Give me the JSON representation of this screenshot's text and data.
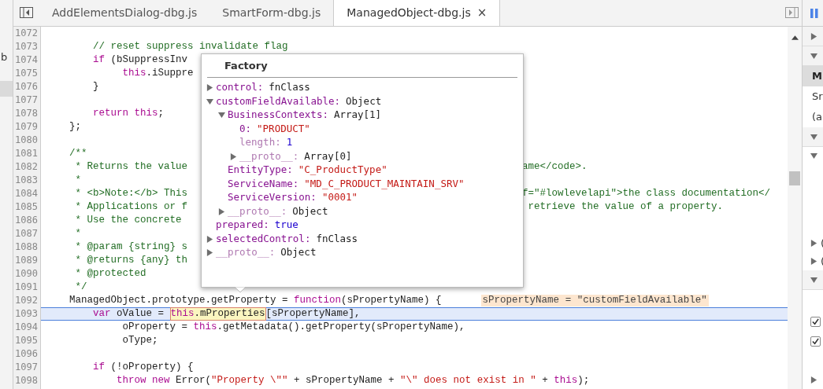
{
  "left_strip": {
    "text": "b"
  },
  "tabs": [
    {
      "label": "AddElementsDialog-dbg.js",
      "selected": false
    },
    {
      "label": "SmartForm-dbg.js",
      "selected": false
    },
    {
      "label": "ManagedObject-dbg.js",
      "selected": true,
      "close": "×"
    }
  ],
  "code": [
    {
      "number": "1072",
      "current": false
    },
    {
      "number": "1073",
      "current": false,
      "tokens": [
        {
          "kind": "comment",
          "text": "        // reset suppress invalidate flag"
        }
      ]
    },
    {
      "number": "1074",
      "current": false,
      "tokens": [
        {
          "kind": "keyword",
          "text": "        if"
        },
        {
          "kind": "plain",
          "text": " (bSuppressInv"
        }
      ]
    },
    {
      "number": "1075",
      "current": false,
      "tokens": [
        {
          "kind": "keyword",
          "text": "             this"
        },
        {
          "kind": "plain",
          "text": ".iSuppre"
        }
      ]
    },
    {
      "number": "1076",
      "current": false,
      "tokens": [
        {
          "kind": "plain",
          "text": "        }"
        }
      ]
    },
    {
      "number": "1077",
      "current": false
    },
    {
      "number": "1078",
      "current": false,
      "tokens": [
        {
          "kind": "keyword",
          "text": "        return this"
        },
        {
          "kind": "plain",
          "text": ";"
        }
      ]
    },
    {
      "number": "1079",
      "current": false,
      "tokens": [
        {
          "kind": "plain",
          "text": "    };"
        }
      ]
    },
    {
      "number": "1080",
      "current": false
    },
    {
      "number": "1081",
      "current": false,
      "tokens": [
        {
          "kind": "comment",
          "text": "    /**"
        }
      ]
    },
    {
      "number": "1082",
      "current": false,
      "tokens": [
        {
          "kind": "comment",
          "text": "     * Returns the value"
        }
      ],
      "right": [
        {
          "kind": "comment",
          "text": "ame</code>."
        }
      ]
    },
    {
      "number": "1083",
      "current": false,
      "tokens": [
        {
          "kind": "comment",
          "text": "     *"
        }
      ]
    },
    {
      "number": "1084",
      "current": false,
      "tokens": [
        {
          "kind": "comment",
          "text": "     * <b>Note:</b> This"
        }
      ],
      "right": [
        {
          "kind": "comment",
          "text": "f=\"#lowlevelapi\">the class documentation</"
        }
      ]
    },
    {
      "number": "1085",
      "current": false,
      "tokens": [
        {
          "kind": "comment",
          "text": "     * Applications or f"
        }
      ],
      "right": [
        {
          "kind": "comment",
          "text": " retrieve the value of a property."
        }
      ]
    },
    {
      "number": "1086",
      "current": false,
      "tokens": [
        {
          "kind": "comment",
          "text": "     * Use the concrete"
        }
      ]
    },
    {
      "number": "1087",
      "current": false,
      "tokens": [
        {
          "kind": "comment",
          "text": "     *"
        }
      ]
    },
    {
      "number": "1088",
      "current": false,
      "tokens": [
        {
          "kind": "comment",
          "text": "     * @param {string} s"
        }
      ]
    },
    {
      "number": "1089",
      "current": false,
      "tokens": [
        {
          "kind": "comment",
          "text": "     * @returns {any} th"
        }
      ]
    },
    {
      "number": "1090",
      "current": false,
      "tokens": [
        {
          "kind": "comment",
          "text": "     * @protected"
        }
      ]
    },
    {
      "number": "1091",
      "current": false,
      "tokens": [
        {
          "kind": "comment",
          "text": "     */"
        }
      ]
    },
    {
      "number": "1092",
      "current": false,
      "tokens": [
        {
          "kind": "plain",
          "text": "    ManagedObject.prototype.getProperty = "
        },
        {
          "kind": "keyword",
          "text": "function"
        },
        {
          "kind": "plain",
          "text": "(sPropertyName) {"
        },
        {
          "kind": "hint",
          "text": "sPropertyName = \"customFieldAvailable\""
        }
      ]
    },
    {
      "number": "1093",
      "current": true,
      "tokens": [
        {
          "kind": "keyword",
          "text": "        var"
        },
        {
          "kind": "plain",
          "text": " oValue = "
        },
        {
          "kind": "highlight",
          "children": [
            {
              "kind": "keyword",
              "text": "this"
            },
            {
              "kind": "plain",
              "text": ".mProperties"
            }
          ]
        },
        {
          "kind": "plain",
          "text": "[sPropertyName],"
        }
      ]
    },
    {
      "number": "1094",
      "current": false,
      "tokens": [
        {
          "kind": "plain",
          "text": "             oProperty = "
        },
        {
          "kind": "keyword",
          "text": "this"
        },
        {
          "kind": "plain",
          "text": ".getMetadata().getProperty(sPropertyName),"
        }
      ]
    },
    {
      "number": "1095",
      "current": false,
      "tokens": [
        {
          "kind": "plain",
          "text": "             oType;"
        }
      ]
    },
    {
      "number": "1096",
      "current": false
    },
    {
      "number": "1097",
      "current": false,
      "tokens": [
        {
          "kind": "keyword",
          "text": "        if"
        },
        {
          "kind": "plain",
          "text": " (!oProperty) {"
        }
      ]
    },
    {
      "number": "1098",
      "current": false,
      "tokens": [
        {
          "kind": "keyword",
          "text": "            throw new"
        },
        {
          "kind": "plain",
          "text": " Error("
        },
        {
          "kind": "string",
          "text": "\"Property \\\"\""
        },
        {
          "kind": "plain",
          "text": " + sPropertyName + "
        },
        {
          "kind": "string",
          "text": "\"\\\" does not exist in \""
        },
        {
          "kind": "plain",
          "text": " + "
        },
        {
          "kind": "keyword",
          "text": "this"
        },
        {
          "kind": "plain",
          "text": ");"
        }
      ]
    }
  ],
  "popup": {
    "title": "Factory",
    "items": [
      {
        "key": "control:",
        "value": "fnClass",
        "kind": "object",
        "internal": false,
        "expanded": false
      },
      {
        "key": "customFieldAvailable:",
        "value": "Object",
        "kind": "object",
        "internal": false,
        "expanded": true,
        "children": [
          {
            "key": "BusinessContexts:",
            "value": "Array[1]",
            "kind": "object",
            "internal": false,
            "expanded": true,
            "children": [
              {
                "key": "0:",
                "value": "\"PRODUCT\"",
                "kind": "string",
                "internal": false
              },
              {
                "key": "length:",
                "value": "1",
                "kind": "number",
                "internal": true
              },
              {
                "key": "__proto__:",
                "value": "Array[0]",
                "kind": "object",
                "internal": true,
                "expanded": false
              }
            ]
          },
          {
            "key": "EntityType:",
            "value": "\"C_ProductType\"",
            "kind": "string",
            "internal": false
          },
          {
            "key": "ServiceName:",
            "value": "\"MD_C_PRODUCT_MAINTAIN_SRV\"",
            "kind": "string",
            "internal": false
          },
          {
            "key": "ServiceVersion:",
            "value": "\"0001\"",
            "kind": "string",
            "internal": false
          },
          {
            "key": "__proto__:",
            "value": "Object",
            "kind": "object",
            "internal": true,
            "expanded": false
          }
        ]
      },
      {
        "key": "prepared:",
        "value": "true",
        "kind": "number",
        "internal": false
      },
      {
        "key": "selectedControl:",
        "value": "fnClass",
        "kind": "object",
        "internal": false,
        "expanded": false
      },
      {
        "key": "__proto__:",
        "value": "Object",
        "kind": "object",
        "internal": true,
        "expanded": false
      }
    ]
  },
  "side_panel": {
    "groups": [
      [
        {
          "kind": "section",
          "expanded": false
        },
        {
          "kind": "section",
          "expanded": true
        },
        {
          "kind": "item",
          "text": "M",
          "selected": true
        },
        {
          "kind": "item",
          "text": "Sr",
          "selected": false
        },
        {
          "kind": "item",
          "text": "(a",
          "selected": false
        },
        {
          "kind": "section",
          "expanded": true
        },
        {
          "kind": "tree",
          "expanded": true
        }
      ],
      [
        {
          "kind": "tree",
          "expanded": false,
          "text": "("
        },
        {
          "kind": "tree",
          "expanded": false,
          "text": "("
        },
        {
          "kind": "section",
          "expanded": true
        }
      ],
      [
        {
          "kind": "checkbox",
          "checked": true
        },
        {
          "kind": "checkbox",
          "checked": true
        }
      ],
      [
        {
          "kind": "tree",
          "expanded": false
        }
      ]
    ]
  }
}
